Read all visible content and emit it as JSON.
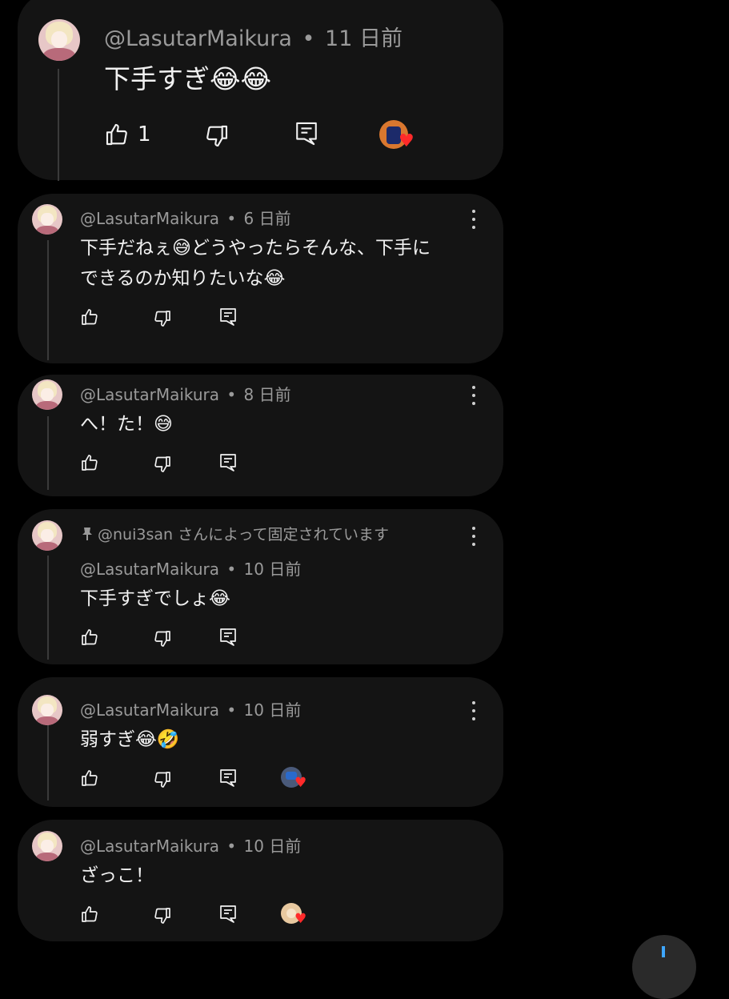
{
  "comments": [
    {
      "author": "@LasutarMaikura",
      "separator": "•",
      "time": "11 日前",
      "text": "下手すぎ😂😂",
      "likes": "1",
      "hearted": true
    },
    {
      "author": "@LasutarMaikura",
      "separator": "•",
      "time": "6 日前",
      "text_line1": "下手だねぇ😅どうやったらそんな、下手に",
      "text_line2": "できるのか知りたいな😂",
      "hearted": false
    },
    {
      "author": "@LasutarMaikura",
      "separator": "•",
      "time": "8 日前",
      "text": "へ！た！😅",
      "hearted": false
    },
    {
      "pinned_text": "@nui3san さんによって固定されています",
      "author": "@LasutarMaikura",
      "separator": "•",
      "time": "10 日前",
      "text": "下手すぎでしょ😂",
      "hearted": false
    },
    {
      "author": "@LasutarMaikura",
      "separator": "•",
      "time": "10 日前",
      "text": "弱すぎ😂🤣",
      "hearted": true
    },
    {
      "author": "@LasutarMaikura",
      "separator": "•",
      "time": "10 日前",
      "text": "ざっこ！",
      "hearted": true
    }
  ],
  "icons": {
    "like": "thumbs-up-icon",
    "dislike": "thumbs-down-icon",
    "reply": "reply-comment-icon",
    "menu": "more-vertical-icon",
    "pin": "pin-icon",
    "heart": "creator-heart-icon"
  },
  "colors": {
    "background": "#000000",
    "card": "#141414",
    "meta_text": "#9a9a9a",
    "heart": "#ff2a2a",
    "fab_accent": "#3ea6ff"
  }
}
